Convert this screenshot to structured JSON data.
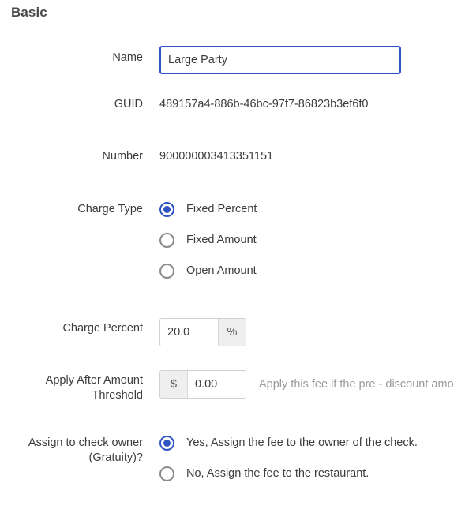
{
  "section": {
    "title": "Basic"
  },
  "fields": {
    "name": {
      "label": "Name",
      "value": "Large Party",
      "placeholder": ""
    },
    "guid": {
      "label": "GUID",
      "value": "489157a4-886b-46bc-97f7-86823b3ef6f0"
    },
    "number": {
      "label": "Number",
      "value": "900000003413351151"
    },
    "charge_type": {
      "label": "Charge Type",
      "options": [
        {
          "label": "Fixed Percent",
          "selected": true
        },
        {
          "label": "Fixed Amount",
          "selected": false
        },
        {
          "label": "Open Amount",
          "selected": false
        }
      ]
    },
    "charge_percent": {
      "label": "Charge Percent",
      "value": "20.0",
      "placeholder": "",
      "addon": "%"
    },
    "threshold": {
      "label": "Apply After Amount Threshold",
      "label_line1": "Apply After Amount",
      "label_line2": "Threshold",
      "value": "0.00",
      "placeholder": "",
      "addon": "$",
      "help_text": "Apply this fee if the pre - discount amo"
    },
    "gratuity": {
      "label_line1": "Assign to check owner",
      "label_line2": "(Gratuity)?",
      "options": [
        {
          "label": "Yes, Assign the fee to the owner of the check.",
          "selected": true
        },
        {
          "label": "No, Assign the fee to the restaurant.",
          "selected": false
        }
      ]
    }
  },
  "colors": {
    "accent": "#2f55c4",
    "text": "#3c3c3c",
    "muted": "#9a9a9a",
    "border": "#d0d0d0",
    "addon_bg": "#efefef"
  }
}
